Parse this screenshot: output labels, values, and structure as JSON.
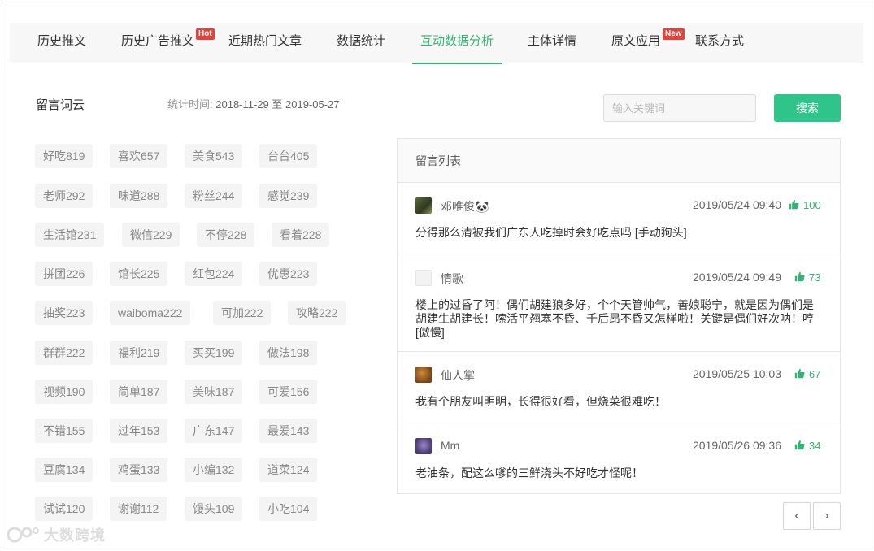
{
  "tabs": [
    {
      "label": "历史推文",
      "badge": ""
    },
    {
      "label": "历史广告推文",
      "badge": "Hot"
    },
    {
      "label": "近期热门文章",
      "badge": ""
    },
    {
      "label": "数据统计",
      "badge": ""
    },
    {
      "label": "互动数据分析",
      "badge": "",
      "active": true
    },
    {
      "label": "主体详情",
      "badge": ""
    },
    {
      "label": "原文应用",
      "badge": "New"
    },
    {
      "label": "联系方式",
      "badge": ""
    }
  ],
  "word_cloud": {
    "title": "留言词云",
    "time_label": "统计时间:",
    "time_range": "2018-11-29 至 2019-05-27",
    "tags": [
      "好吃819",
      "喜欢657",
      "美食543",
      "台台405",
      "老师292",
      "味道288",
      "粉丝244",
      "感觉239",
      "生活馆231",
      "微信229",
      "不停228",
      "看着228",
      "拼团226",
      "馆长225",
      "红包224",
      "优惠223",
      "抽奖223",
      "waiboma222",
      "可加222",
      "攻略222",
      "群群222",
      "福利219",
      "买买199",
      "做法198",
      "视频190",
      "简单187",
      "美味187",
      "可爱156",
      "不错155",
      "过年153",
      "广东147",
      "最爱143",
      "豆腐134",
      "鸡蛋133",
      "小编132",
      "道菜124",
      "试试120",
      "谢谢112",
      "馒头109",
      "小吃104"
    ]
  },
  "search": {
    "placeholder": "输入关键词",
    "button_label": "搜索"
  },
  "comments": {
    "title": "留言列表",
    "items": [
      {
        "user": "邓唯俊🐼",
        "time": "2019/05/24 09:40",
        "likes": "100",
        "text": "分得那么清被我们广东人吃掉时会好吃点吗 [手动狗头]"
      },
      {
        "user": "情歌",
        "time": "2019/05/24 09:49",
        "likes": "73",
        "text": "楼上的过昏了阿！偶们胡建狼多好，个个天管帅气，善娘聪宁，就是因为偶们是胡建生胡建长！嗦活平翘塞不昏、千后昂不昏又怎样啦！关键是偶们好次呐！哼[傲慢]"
      },
      {
        "user": "仙人掌",
        "time": "2019/05/25 10:03",
        "likes": "67",
        "text": "我有个朋友叫明明，长得很好看，但烧菜很难吃！"
      },
      {
        "user": "Mm",
        "time": "2019/05/26 09:36",
        "likes": "34",
        "text": "老油条，配这么嗲的三鲜浇头不好吃才怪呢！"
      }
    ]
  },
  "pagination": {
    "prev": "‹",
    "next": "›"
  },
  "watermark": "大数跨境",
  "colors": {
    "accent": "#35b376",
    "button": "#2fc58a",
    "badge": "#e7423a"
  }
}
